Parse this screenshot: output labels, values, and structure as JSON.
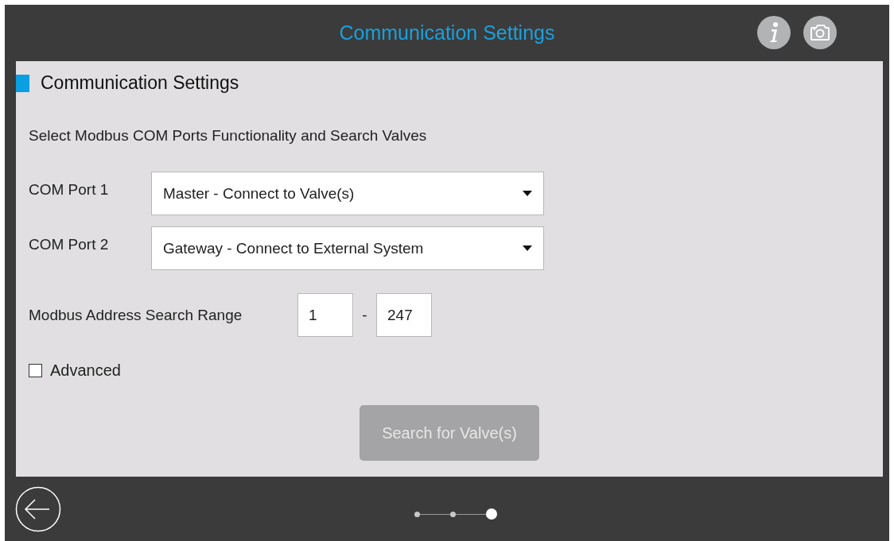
{
  "header": {
    "title": "Communication Settings"
  },
  "section": {
    "title": "Communication Settings",
    "description": "Select Modbus COM Ports Functionality and Search Valves"
  },
  "com_ports": [
    {
      "label": "COM Port 1",
      "value": "Master - Connect to Valve(s)"
    },
    {
      "label": "COM Port 2",
      "value": "Gateway - Connect to External System"
    }
  ],
  "address_range": {
    "label": "Modbus Address Search Range",
    "from": "1",
    "separator": "-",
    "to": "247"
  },
  "advanced": {
    "label": "Advanced",
    "checked": false
  },
  "search_button": {
    "label": "Search for Valve(s)",
    "disabled": true
  },
  "steps": [
    {
      "selected": false
    },
    {
      "selected": false
    },
    {
      "selected": true
    }
  ]
}
